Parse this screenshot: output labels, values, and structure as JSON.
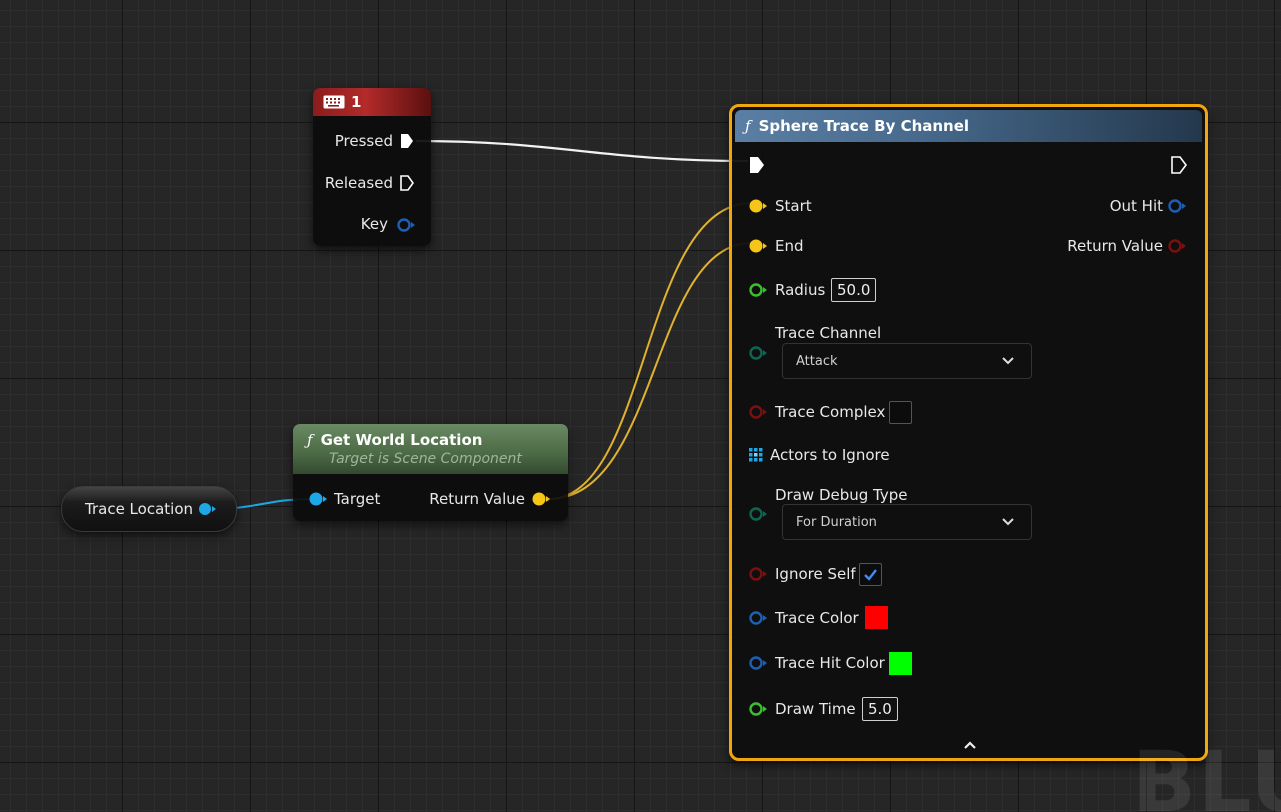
{
  "input_node": {
    "title": "1",
    "pins": {
      "pressed": "Pressed",
      "released": "Released",
      "key": "Key"
    },
    "header_icon": "keyboard-icon"
  },
  "variable_node": {
    "label": "Trace Location"
  },
  "get_world_location": {
    "title": "Get World Location",
    "subtitle": "Target is Scene Component",
    "input_label": "Target",
    "output_label": "Return Value",
    "icon": "function-icon"
  },
  "sphere_trace": {
    "title": "Sphere Trace By Channel",
    "icon": "function-icon",
    "inputs": {
      "start": "Start",
      "end": "End",
      "radius": "Radius",
      "radius_value": "50.0",
      "trace_channel": "Trace Channel",
      "trace_channel_value": "Attack",
      "trace_complex": "Trace Complex",
      "actors_to_ignore": "Actors to Ignore",
      "draw_debug_type": "Draw Debug Type",
      "draw_debug_value": "For Duration",
      "ignore_self": "Ignore Self",
      "trace_color": "Trace Color",
      "trace_hit_color": "Trace Hit Color",
      "draw_time": "Draw Time",
      "draw_time_value": "5.0"
    },
    "outputs": {
      "out_hit": "Out Hit",
      "return_value": "Return Value"
    },
    "trace_complex_checked": false,
    "ignore_self_checked": true
  },
  "colors": {
    "exec": "#ffffff",
    "vector_pin": "#f5c518",
    "float_pin": "#3bbf2d",
    "object_pin": "#1ea7e8",
    "struct_pin": "#1d5fb3",
    "bool_pin": "#7a1010",
    "byte_pin": "#0d6650",
    "selection_outline": "#f2a60e",
    "trace_color": "#ff0000",
    "trace_hit_color": "#00ff00"
  },
  "watermark": "BLU"
}
